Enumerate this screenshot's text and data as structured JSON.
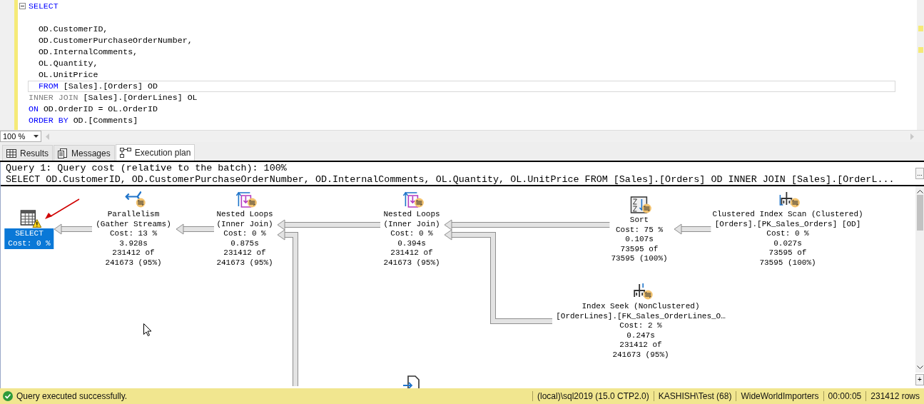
{
  "editor": {
    "lines": [
      {
        "kind": "code",
        "current": false,
        "tokens": [
          {
            "t": "SELECT",
            "kind": "keyword"
          }
        ]
      },
      {
        "kind": "blank"
      },
      {
        "kind": "code",
        "current": false,
        "tokens": [
          {
            "t": "  OD.CustomerID,",
            "kind": "plain"
          }
        ]
      },
      {
        "kind": "code",
        "current": false,
        "tokens": [
          {
            "t": "  OD.CustomerPurchaseOrderNumber,",
            "kind": "plain"
          }
        ]
      },
      {
        "kind": "code",
        "current": false,
        "tokens": [
          {
            "t": "  OD.InternalComments,",
            "kind": "plain"
          }
        ]
      },
      {
        "kind": "code",
        "current": false,
        "tokens": [
          {
            "t": "  OL.Quantity,",
            "kind": "plain"
          }
        ]
      },
      {
        "kind": "code",
        "current": false,
        "tokens": [
          {
            "t": "  OL.UnitPrice",
            "kind": "plain"
          }
        ]
      },
      {
        "kind": "code",
        "current": true,
        "tokens": [
          {
            "t": "  FROM",
            "kind": "keyword"
          },
          {
            "t": "[Sales].[Orders] OD",
            "kind": "plain"
          }
        ]
      },
      {
        "kind": "code",
        "current": false,
        "tokens": [
          {
            "t": "INNER JOIN",
            "kind": "gray"
          },
          {
            "t": "[Sales].[OrderLines] OL",
            "kind": "plain"
          }
        ]
      },
      {
        "kind": "code",
        "current": false,
        "tokens": [
          {
            "t": "ON",
            "kind": "keyword"
          },
          {
            "t": "OD.OrderID = OL.OrderID",
            "kind": "plain"
          }
        ]
      },
      {
        "kind": "code",
        "current": false,
        "tokens": [
          {
            "t": "ORDER BY",
            "kind": "keyword"
          },
          {
            "t": "OD.[Comments]",
            "kind": "plain"
          }
        ]
      }
    ]
  },
  "zoom": {
    "value": "100 %"
  },
  "tabs": [
    {
      "label": "Results",
      "kind": "grid",
      "selected": false
    },
    {
      "label": "Messages",
      "kind": "messages",
      "selected": false
    },
    {
      "label": "Execution plan",
      "kind": "plan",
      "selected": true
    }
  ],
  "plan": {
    "header": [
      "Query 1: Query cost (relative to the batch): 100%",
      "SELECT OD.CustomerID, OD.CustomerPurchaseOrderNumber, OD.InternalComments, OL.Quantity, OL.UnitPrice FROM [Sales].[Orders] OD INNER JOIN [Sales].[OrderL..."
    ],
    "header_button": "...",
    "nodes": [
      {
        "kind": "select",
        "warning": true,
        "parallel": false,
        "selected": true,
        "lines": [
          "SELECT",
          "Cost: 0 %"
        ]
      },
      {
        "kind": "parallelism",
        "warning": false,
        "parallel": true,
        "selected": false,
        "lines": [
          "Parallelism",
          "(Gather Streams)",
          "Cost: 13 %",
          "3.928s",
          "231412 of",
          "241673 (95%)"
        ]
      },
      {
        "kind": "nested_loops",
        "warning": false,
        "parallel": true,
        "selected": false,
        "lines": [
          "Nested Loops",
          "(Inner Join)",
          "Cost: 0 %",
          "0.875s",
          "231412 of",
          "241673 (95%)"
        ]
      },
      {
        "kind": "nested_loops",
        "warning": false,
        "parallel": true,
        "selected": false,
        "lines": [
          "Nested Loops",
          "(Inner Join)",
          "Cost: 0 %",
          "0.394s",
          "231412 of",
          "241673 (95%)"
        ]
      },
      {
        "kind": "sort",
        "warning": false,
        "parallel": true,
        "selected": false,
        "lines": [
          "Sort",
          "Cost: 75 %",
          "0.107s",
          "73595 of",
          "73595 (100%)"
        ]
      },
      {
        "kind": "clustered_index_scan",
        "warning": false,
        "parallel": true,
        "selected": false,
        "lines": [
          "Clustered Index Scan (Clustered)",
          "[Orders].[PK_Sales_Orders] [OD]",
          "Cost: 0 %",
          "0.027s",
          "73595 of",
          "73595 (100%)"
        ]
      },
      {
        "kind": "index_seek",
        "warning": false,
        "parallel": true,
        "selected": false,
        "lines": [
          "Index Seek (NonClustered)",
          "[OrderLines].[FK_Sales_OrderLines_O…",
          "Cost: 2 %",
          "0.247s",
          "231412 of",
          "241673 (95%)"
        ]
      },
      {
        "kind": "key_lookup"
      }
    ],
    "expand_button": "+"
  },
  "status_bar": {
    "message": "Query executed successfully.",
    "success": true,
    "segments": [
      "(local)\\sql2019 (15.0 CTP2.0)",
      "KASHISH\\Test (68)",
      "WideWorldImporters",
      "00:00:05",
      "231412 rows"
    ]
  }
}
